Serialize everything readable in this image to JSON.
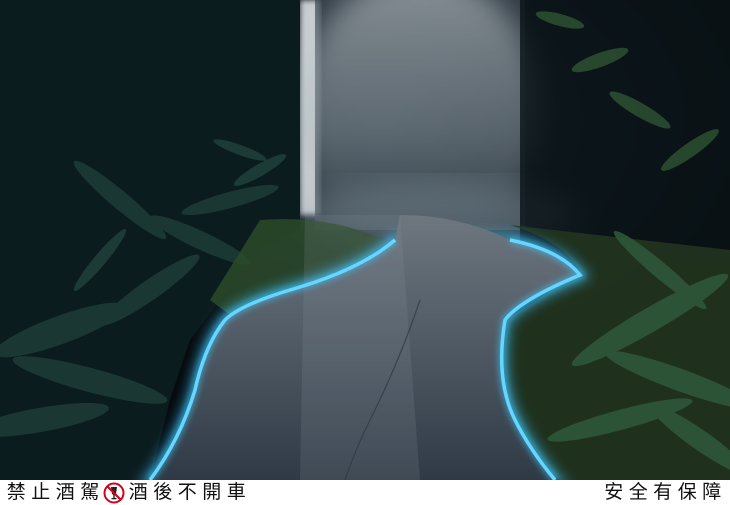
{
  "image": {
    "subject": "Dark indoor jungle installation with mist and a glowing blue-lit winding concrete path",
    "colors": {
      "glow": "#3fc8ff",
      "path": "#5a6470",
      "foliage": "#0d2426",
      "mist": "#b8c0c6"
    }
  },
  "warning": {
    "part1_chars": [
      "禁",
      "止",
      "酒",
      "駕"
    ],
    "icon": "no-drinking-icon",
    "part2_chars": [
      "酒",
      "後",
      "不",
      "開",
      "車"
    ],
    "part3_chars": [
      "安",
      "全",
      "有",
      "保",
      "障"
    ],
    "accent": "#d0021b"
  }
}
